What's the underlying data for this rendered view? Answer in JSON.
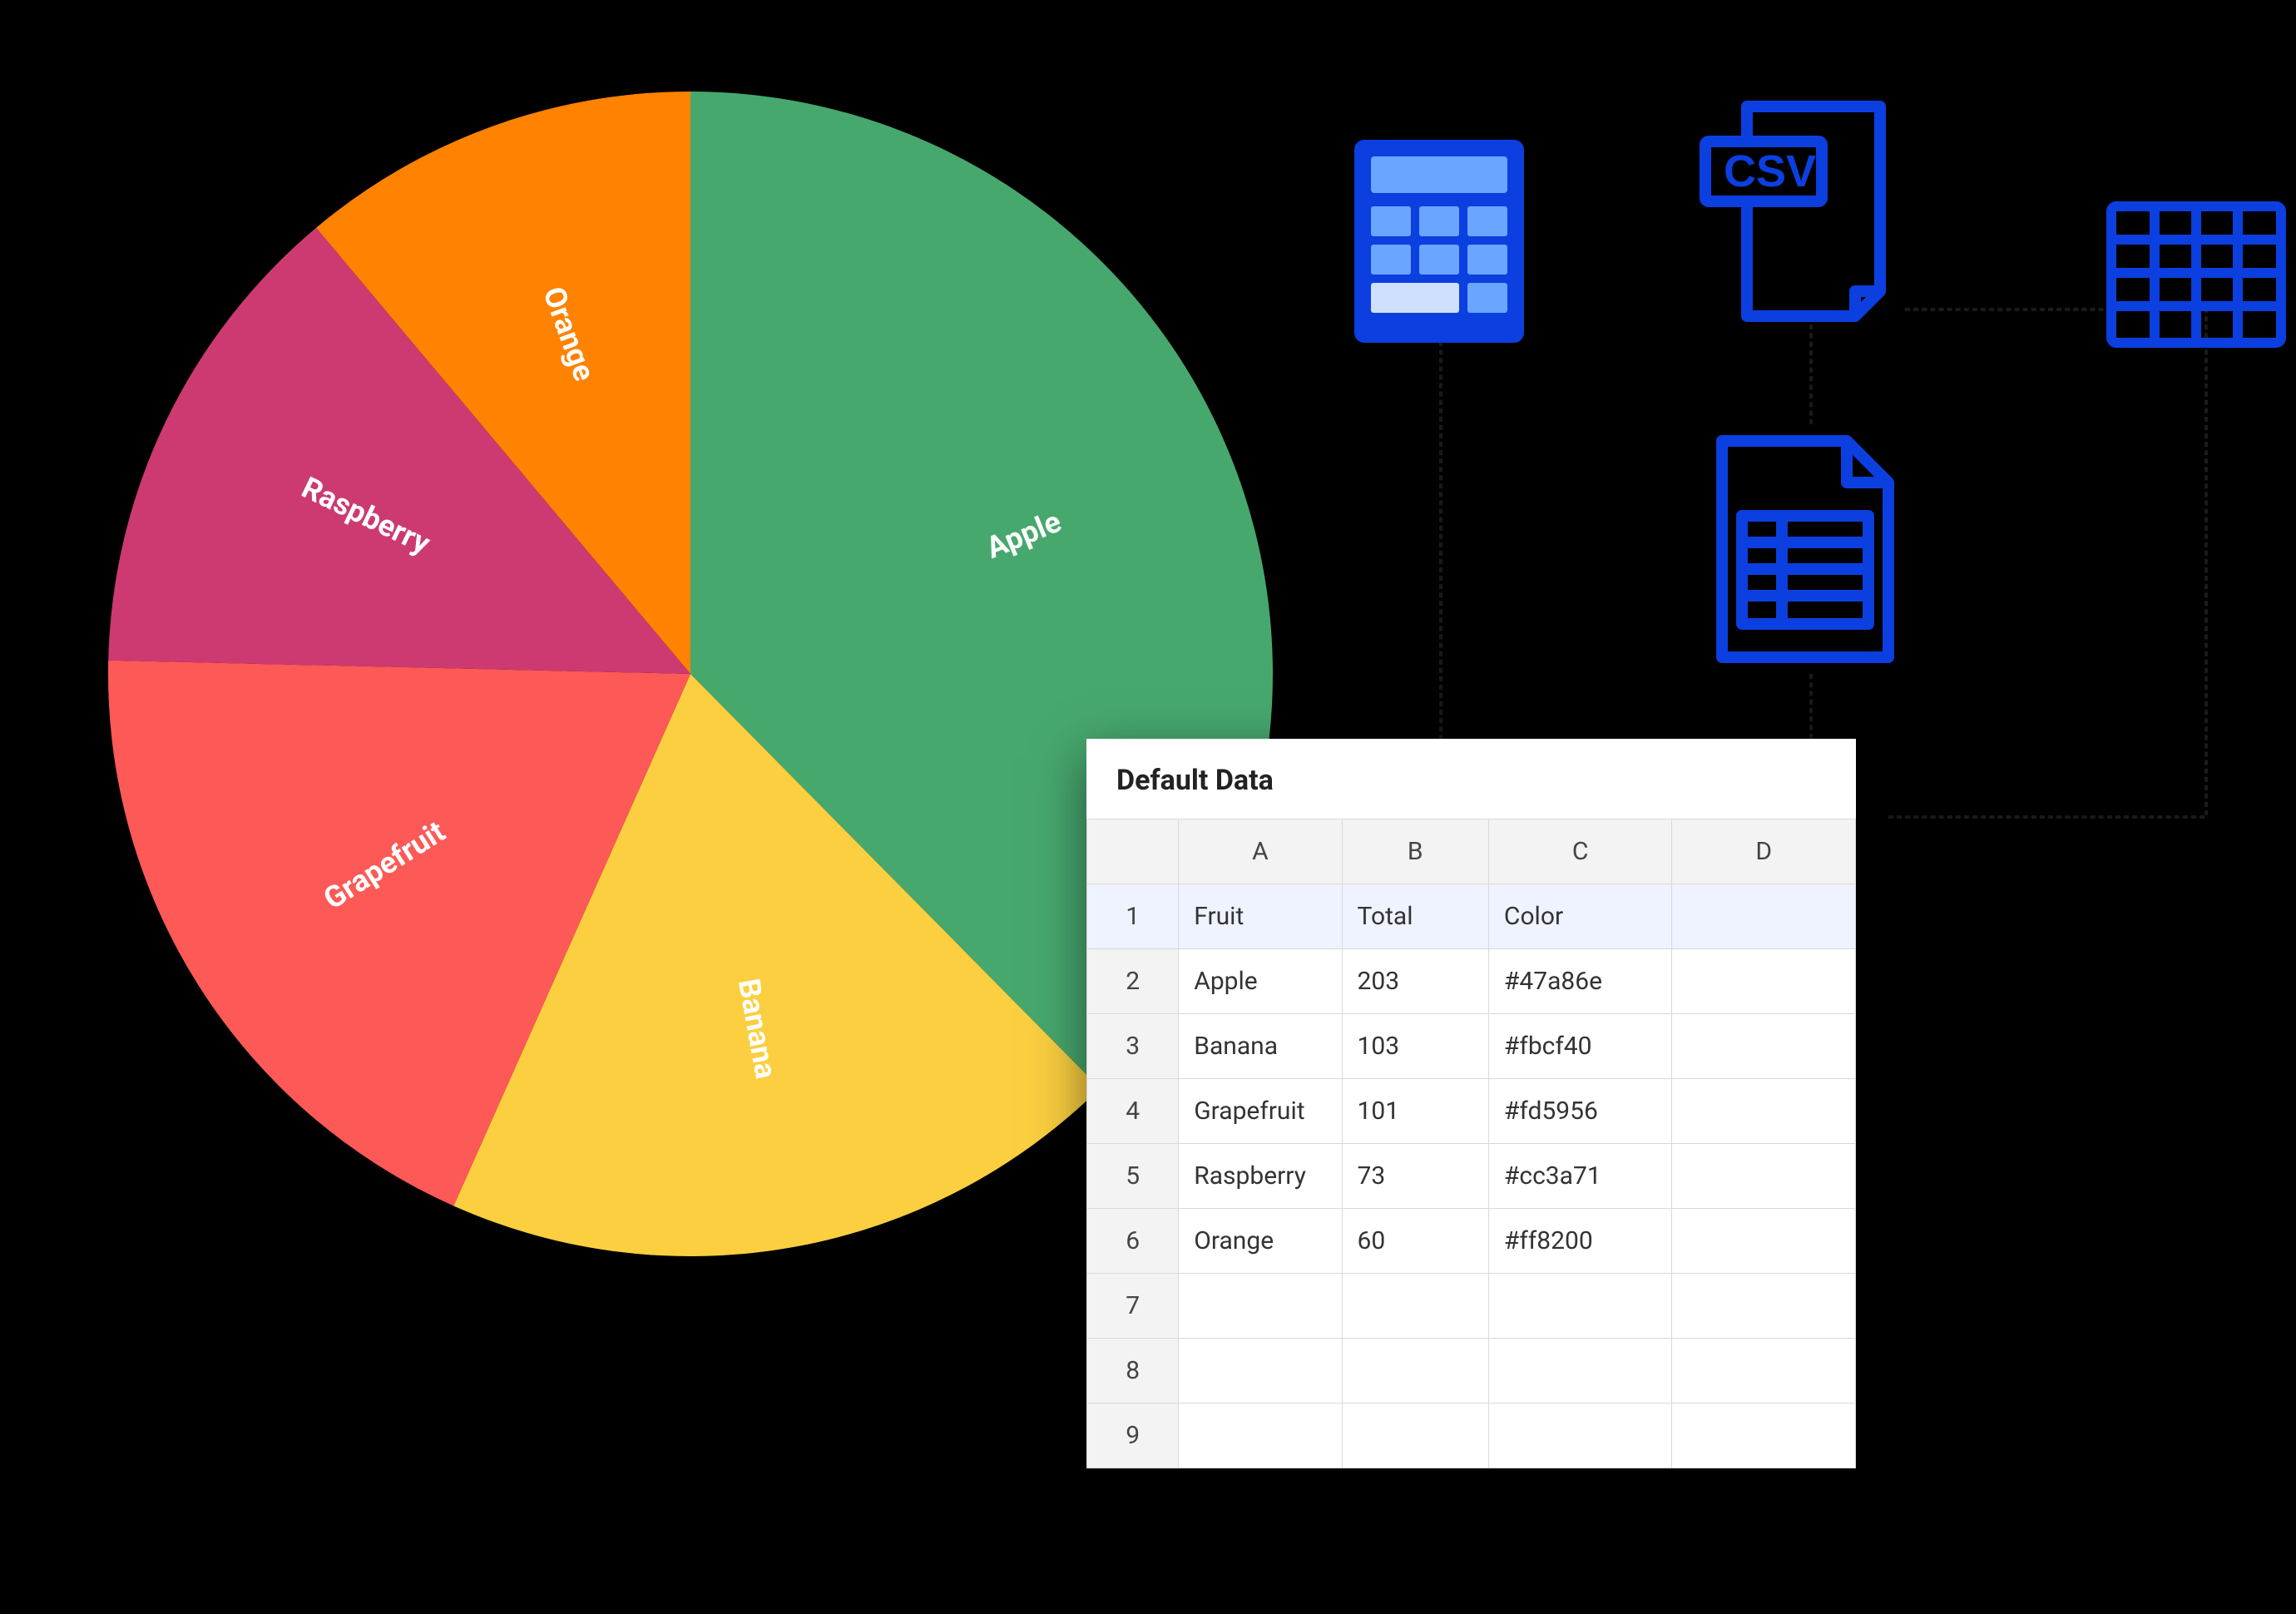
{
  "chart_data": {
    "type": "pie",
    "title": "",
    "slices": [
      {
        "label": "Apple",
        "value": 203,
        "color": "#47a86e"
      },
      {
        "label": "Banana",
        "value": 103,
        "color": "#fbcf40"
      },
      {
        "label": "Grapefruit",
        "value": 101,
        "color": "#fd5956"
      },
      {
        "label": "Raspberry",
        "value": 73,
        "color": "#cc3a71"
      },
      {
        "label": "Orange",
        "value": 60,
        "color": "#ff8200"
      }
    ]
  },
  "sheet": {
    "title": "Default Data",
    "columns": [
      "A",
      "B",
      "C",
      "D"
    ],
    "header_row": {
      "A": "Fruit",
      "B": "Total",
      "C": "Color",
      "D": ""
    },
    "rows": [
      {
        "n": "1",
        "A": "Fruit",
        "B": "Total",
        "C": "Color",
        "D": "",
        "selected": true
      },
      {
        "n": "2",
        "A": "Apple",
        "B": "203",
        "C": "#47a86e",
        "D": "",
        "selected": false
      },
      {
        "n": "3",
        "A": "Banana",
        "B": "103",
        "C": "#fbcf40",
        "D": "",
        "selected": false
      },
      {
        "n": "4",
        "A": "Grapefruit",
        "B": "101",
        "C": "#fd5956",
        "D": "",
        "selected": false
      },
      {
        "n": "5",
        "A": "Raspberry",
        "B": "73",
        "C": "#cc3a71",
        "D": "",
        "selected": false
      },
      {
        "n": "6",
        "A": "Orange",
        "B": "60",
        "C": "#ff8200",
        "D": "",
        "selected": false
      },
      {
        "n": "7",
        "A": "",
        "B": "",
        "C": "",
        "D": "",
        "selected": false
      },
      {
        "n": "8",
        "A": "",
        "B": "",
        "C": "",
        "D": "",
        "selected": false
      },
      {
        "n": "9",
        "A": "",
        "B": "",
        "C": "",
        "D": "",
        "selected": false
      }
    ]
  },
  "icons": {
    "calculator": "calculator-icon",
    "csv": "csv-file-icon",
    "csv_label": "CSV",
    "grid": "grid-icon",
    "doc_table": "document-table-icon"
  }
}
